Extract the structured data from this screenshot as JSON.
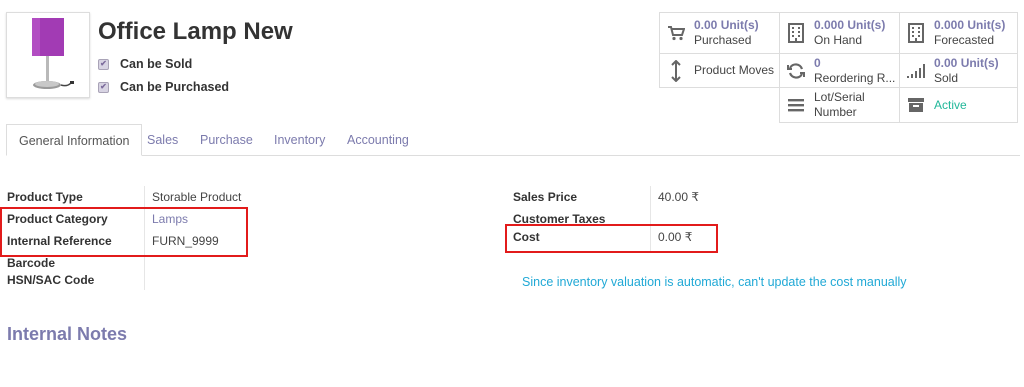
{
  "product": {
    "name": "Office Lamp New",
    "can_be_sold_label": "Can be Sold",
    "can_be_purchased_label": "Can be Purchased"
  },
  "stats": {
    "purchased": {
      "value": "0.00 Unit(s)",
      "label": "Purchased",
      "icon": "shopping-cart-icon"
    },
    "on_hand": {
      "value": "0.000 Unit(s)",
      "label": "On Hand",
      "icon": "building-icon"
    },
    "forecasted": {
      "value": "0.000 Unit(s)",
      "label": "Forecasted",
      "icon": "building-icon"
    },
    "product_moves": {
      "label": "Product Moves",
      "icon": "arrows-vertical-icon"
    },
    "reordering": {
      "value": "0",
      "label": "Reordering R...",
      "icon": "refresh-icon"
    },
    "sold": {
      "value": "0.00 Unit(s)",
      "label": "Sold",
      "icon": "signal-bars-icon"
    },
    "lot_serial": {
      "label_line1": "Lot/Serial",
      "label_line2": "Number",
      "icon": "list-icon"
    },
    "active": {
      "label": "Active",
      "icon": "archive-icon"
    }
  },
  "tabs": [
    "General Information",
    "Sales",
    "Purchase",
    "Inventory",
    "Accounting"
  ],
  "general": {
    "product_type_label": "Product Type",
    "product_type_value": "Storable Product",
    "product_category_label": "Product Category",
    "product_category_value": "Lamps",
    "internal_reference_label": "Internal Reference",
    "internal_reference_value": "FURN_9999",
    "barcode_label": "Barcode",
    "hsn_label": "HSN/SAC Code",
    "sales_price_label": "Sales Price",
    "sales_price_value": "40.00 ₹",
    "customer_taxes_label": "Customer Taxes",
    "cost_label": "Cost",
    "cost_value": "0.00 ₹",
    "valuation_note": "Since inventory valuation is automatic, can't update the cost manually"
  },
  "internal_notes_title": "Internal Notes",
  "colors": {
    "accent": "#7c7bad",
    "active_green": "#21b799",
    "info_blue": "#21a9d6",
    "highlight_red": "#e21b1b"
  }
}
